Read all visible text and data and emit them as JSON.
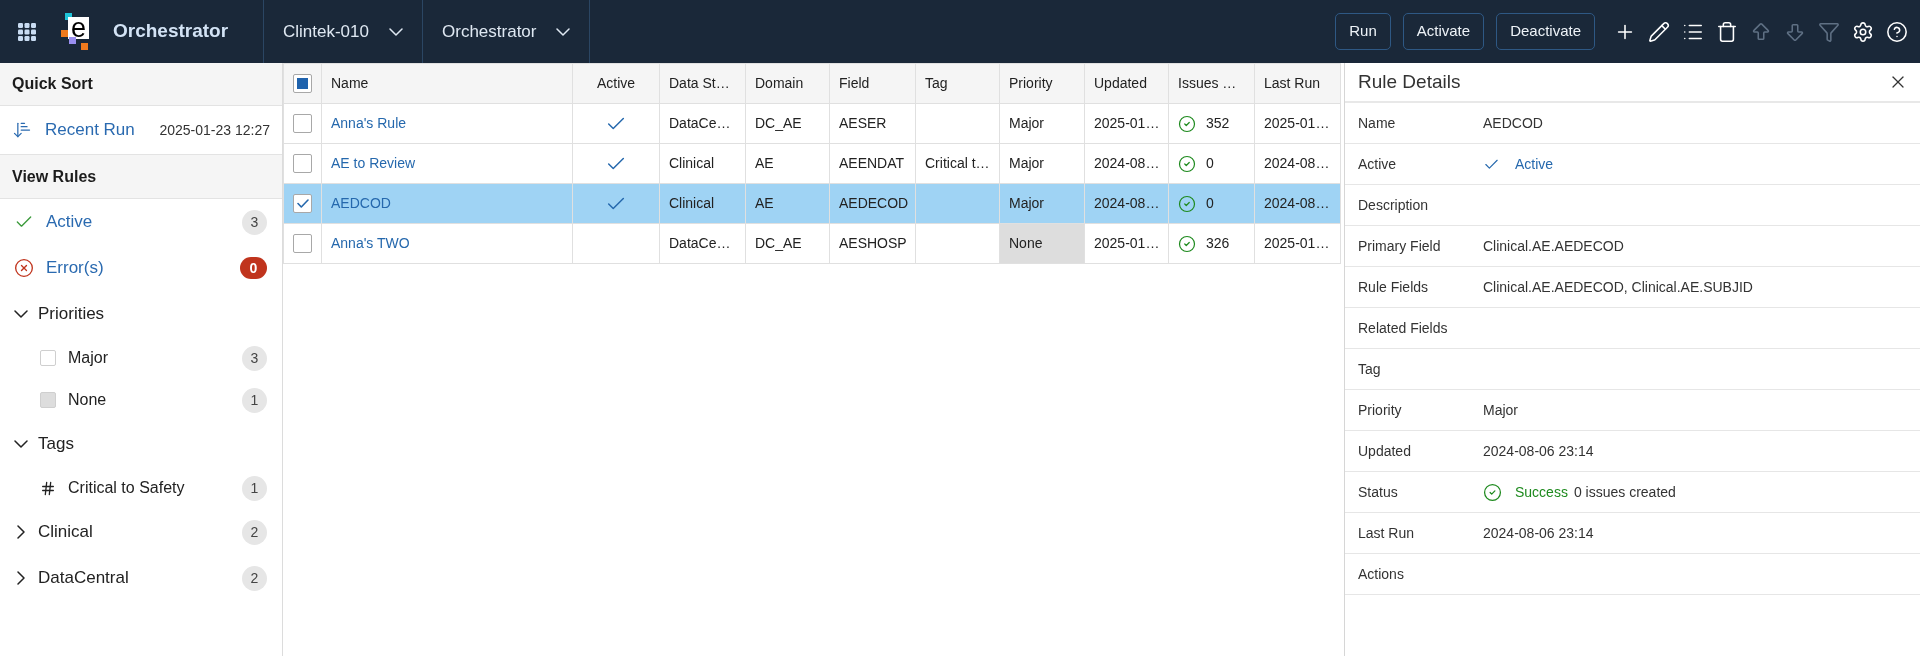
{
  "app_bar": {
    "logo": {
      "letter": "e"
    },
    "app_name": "Orchestrator",
    "selectors": [
      {
        "label": "Clintek-010"
      },
      {
        "label": "Orchestrator"
      }
    ],
    "buttons": [
      "Run",
      "Activate",
      "Deactivate"
    ],
    "tools": [
      {
        "kind": "add",
        "disabled": false
      },
      {
        "kind": "edit",
        "disabled": false
      },
      {
        "kind": "list",
        "disabled": false
      },
      {
        "kind": "delete",
        "disabled": false
      },
      {
        "kind": "up",
        "disabled": true
      },
      {
        "kind": "down",
        "disabled": true
      },
      {
        "kind": "filter",
        "disabled": true
      },
      {
        "kind": "settings",
        "disabled": false
      },
      {
        "kind": "help",
        "disabled": false
      }
    ]
  },
  "sidebar": {
    "quick_sort": {
      "title": "Quick Sort",
      "items": [
        {
          "label": "Recent Run",
          "value": "2025-01-23 12:27"
        }
      ]
    },
    "view_rules": {
      "title": "View Rules",
      "filters": [
        {
          "kind": "active",
          "label": "Active",
          "count": "3"
        },
        {
          "kind": "error",
          "label": "Error(s)",
          "count": "0"
        }
      ],
      "groups": [
        {
          "label": "Priorities",
          "expanded": true,
          "children": [
            {
              "kind": "priority",
              "label": "Major",
              "count": "3",
              "color": "#ffffff"
            },
            {
              "kind": "priority",
              "label": "None",
              "count": "1",
              "color": "#dddddd"
            }
          ]
        },
        {
          "label": "Tags",
          "expanded": true,
          "children": [
            {
              "kind": "tag",
              "label": "Critical to Safety",
              "count": "1"
            }
          ]
        },
        {
          "label": "Clinical",
          "expanded": false,
          "count": "2"
        },
        {
          "label": "DataCentral",
          "expanded": false,
          "count": "2"
        }
      ]
    }
  },
  "table": {
    "select_all": {
      "indeterminate": true
    },
    "columns": [
      "Name",
      "Active",
      "Data St…",
      "Domain",
      "Field",
      "Tag",
      "Priority",
      "Updated",
      "Issues …",
      "Last Run"
    ],
    "rows": [
      {
        "selected": false,
        "name": "Anna's Rule",
        "active": true,
        "column_3": "DataCe…",
        "domain": "DC_AE",
        "field": "AESER",
        "priority": "Major",
        "priority_highlighted": false,
        "updated": "2025-01…",
        "column_9": "352",
        "last_run": "2025-01…"
      },
      {
        "selected": false,
        "name": "AE to Review",
        "active": true,
        "column_3": "Clinical",
        "domain": "AE",
        "field": "AEENDAT",
        "tag": "Critical t…",
        "priority": "Major",
        "priority_highlighted": false,
        "updated": "2024-08…",
        "column_9": "0",
        "last_run": "2024-08…"
      },
      {
        "selected": true,
        "name": "AEDCOD",
        "active": true,
        "column_3": "Clinical",
        "domain": "AE",
        "field": "AEDECOD",
        "priority": "Major",
        "priority_highlighted": false,
        "updated": "2024-08…",
        "column_9": "0",
        "last_run": "2024-08…"
      },
      {
        "selected": false,
        "name": "Anna's TWO",
        "active": false,
        "column_3": "DataCe…",
        "domain": "DC_AE",
        "field": "AESHOSP",
        "priority": "None",
        "priority_highlighted": true,
        "updated": "2025-01…",
        "column_9": "326",
        "last_run": "2025-01…"
      }
    ]
  },
  "details": {
    "title": "Rule Details",
    "fields": [
      {
        "kind": "text",
        "label": "Name",
        "value": "AEDCOD"
      },
      {
        "kind": "active",
        "label": "Active",
        "value": "Active"
      },
      {
        "kind": "text",
        "label": "Description"
      },
      {
        "kind": "text",
        "label": "Primary Field",
        "value": "Clinical.AE.AEDECOD"
      },
      {
        "kind": "text",
        "label": "Rule Fields",
        "value": "Clinical.AE.AEDECOD, Clinical.AE.SUBJID"
      },
      {
        "kind": "text",
        "label": "Related Fields"
      },
      {
        "kind": "text",
        "label": "Tag"
      },
      {
        "kind": "text",
        "label": "Priority",
        "value": "Major"
      },
      {
        "kind": "text",
        "label": "Updated",
        "value": "2024-08-06 23:14"
      },
      {
        "kind": "status",
        "label": "Status",
        "status": "Success",
        "value": "0 issues created"
      },
      {
        "kind": "text",
        "label": "Last Run",
        "value": "2024-08-06 23:14"
      },
      {
        "kind": "text",
        "label": "Actions"
      }
    ]
  }
}
